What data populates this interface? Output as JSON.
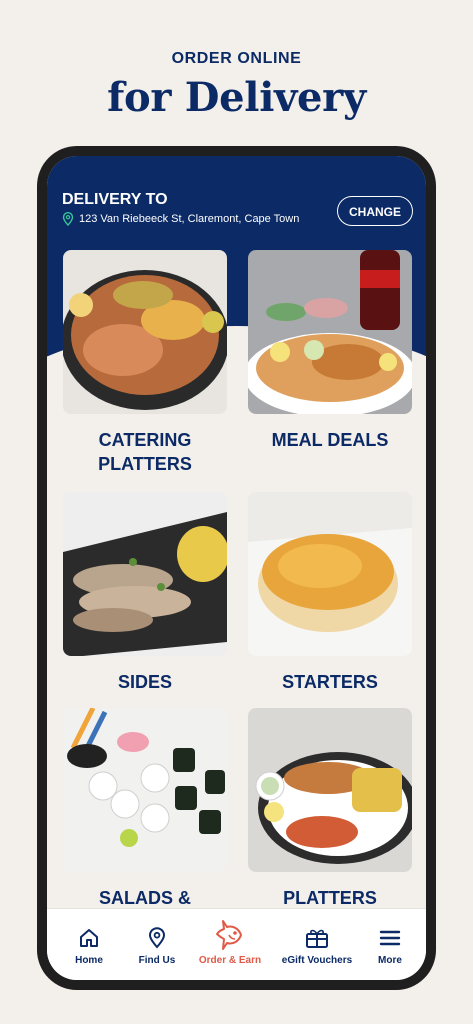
{
  "promo": {
    "line1": "ORDER ONLINE",
    "line2": "for Delivery"
  },
  "header": {
    "title": "DELIVERY TO",
    "address": "123 Van Riebeeck St, Claremont, Cape Town",
    "change_label": "CHANGE"
  },
  "categories": [
    {
      "label": "CATERING PLATTERS",
      "image": "seafood-platter"
    },
    {
      "label": "MEAL DEALS",
      "image": "meal-deal"
    },
    {
      "label": "SIDES",
      "image": "calamari-side"
    },
    {
      "label": "STARTERS",
      "image": "garlic-roll"
    },
    {
      "label": "SALADS &",
      "image": "sushi"
    },
    {
      "label": "PLATTERS",
      "image": "fish-and-chips"
    }
  ],
  "nav": {
    "items": [
      {
        "label": "Home",
        "icon": "home-icon"
      },
      {
        "label": "Find Us",
        "icon": "location-pin-icon"
      },
      {
        "label": "Order & Earn",
        "icon": "fish-icon"
      },
      {
        "label": "eGift Vouchers",
        "icon": "gift-icon"
      },
      {
        "label": "More",
        "icon": "menu-icon"
      }
    ]
  },
  "colors": {
    "brand_navy": "#0b2a66",
    "accent_coral": "#e05a47",
    "background": "#f3efea"
  }
}
